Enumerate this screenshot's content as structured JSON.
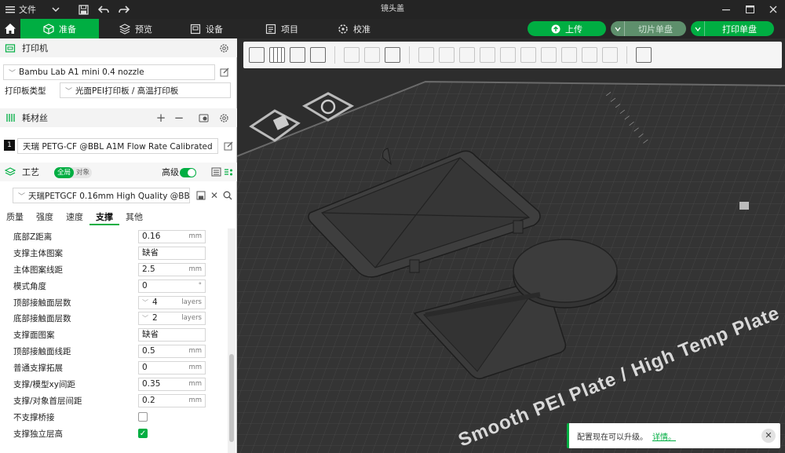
{
  "window": {
    "title": "镜头盖",
    "file_menu": "文件"
  },
  "tabs": [
    {
      "label": "准备",
      "icon": "cube-icon",
      "active": true
    },
    {
      "label": "预览",
      "icon": "layers-icon"
    },
    {
      "label": "设备",
      "icon": "device-icon"
    },
    {
      "label": "项目",
      "icon": "project-icon"
    },
    {
      "label": "校准",
      "icon": "calibration-icon"
    }
  ],
  "actions": {
    "upload": "上传",
    "slice": "切片单盘",
    "print": "打印单盘"
  },
  "printer": {
    "section_title": "打印机",
    "name": "Bambu Lab A1 mini 0.4 nozzle",
    "plate_type_label": "打印板类型",
    "plate_type_value": "光面PEI打印板 / 高温打印板"
  },
  "filament": {
    "section_title": "耗材丝",
    "slot": "1",
    "name": "天瑞 PETG-CF @BBL A1M Flow Rate Calibrated"
  },
  "process": {
    "section_title": "工艺",
    "mode_global": "全局",
    "mode_object": "对象",
    "advanced_label": "高级",
    "preset": "天瑞PETGCF 0.16mm High Quality @BB..."
  },
  "subtabs": [
    "质量",
    "强度",
    "速度",
    "支撑",
    "其他"
  ],
  "active_subtab": "支撑",
  "params": [
    {
      "label": "底部Z距离",
      "value": "0.16",
      "unit": "mm"
    },
    {
      "label": "支撑主体图案",
      "value": "缺省",
      "unit": ""
    },
    {
      "label": "主体图案线距",
      "value": "2.5",
      "unit": "mm"
    },
    {
      "label": "模式角度",
      "value": "0",
      "unit": "°"
    },
    {
      "label": "顶部接触面层数",
      "value": "4",
      "unit": "layers",
      "dropdown": true
    },
    {
      "label": "底部接触面层数",
      "value": "2",
      "unit": "layers",
      "dropdown": true
    },
    {
      "label": "支撑面图案",
      "value": "缺省",
      "unit": ""
    },
    {
      "label": "顶部接触面线距",
      "value": "0.5",
      "unit": "mm"
    },
    {
      "label": "普通支撑拓展",
      "value": "0",
      "unit": "mm"
    },
    {
      "label": "支撑/模型xy间距",
      "value": "0.35",
      "unit": "mm"
    },
    {
      "label": "支撑/对象首层间距",
      "value": "0.2",
      "unit": "mm"
    },
    {
      "label": "不支撑桥接",
      "checkbox": true,
      "checked": false
    },
    {
      "label": "支撑独立层高",
      "checkbox": true,
      "checked": true
    }
  ],
  "plate_text": "Smooth PEI Plate / High Temp Plate",
  "notification": {
    "text": "配置现在可以升级。",
    "link": "详情。"
  },
  "colors": {
    "accent": "#00ae42",
    "titlebar": "#242424",
    "viewport": "#2d2d2d"
  }
}
